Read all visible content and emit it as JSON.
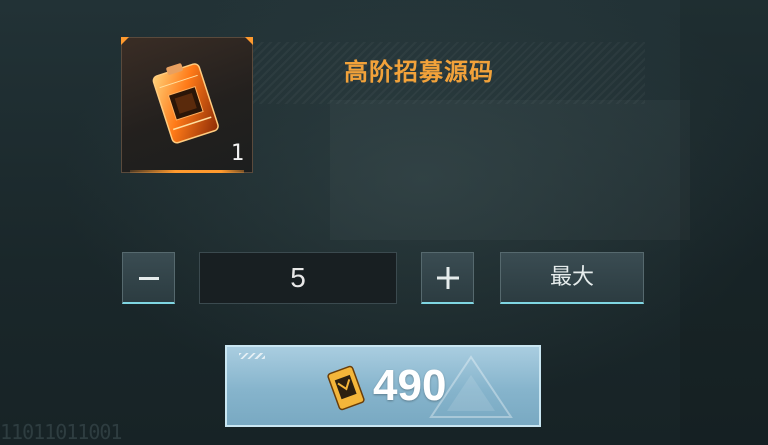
{
  "item": {
    "name": "高阶招募源码",
    "owned_count": "1",
    "icon": "recruit-code-chip-icon"
  },
  "quantity": {
    "value": "5",
    "minus_symbol": "—",
    "plus_symbol": "+",
    "max_label": "最大"
  },
  "purchase": {
    "price": "490",
    "currency_icon": "gold-chip-currency-icon"
  },
  "footer_code": "11011011001",
  "colors": {
    "accent_orange": "#ff9a2e",
    "title_gold": "#f2a23a",
    "button_glow": "#7fd6e2",
    "confirm_blue": "#86b4cc"
  }
}
